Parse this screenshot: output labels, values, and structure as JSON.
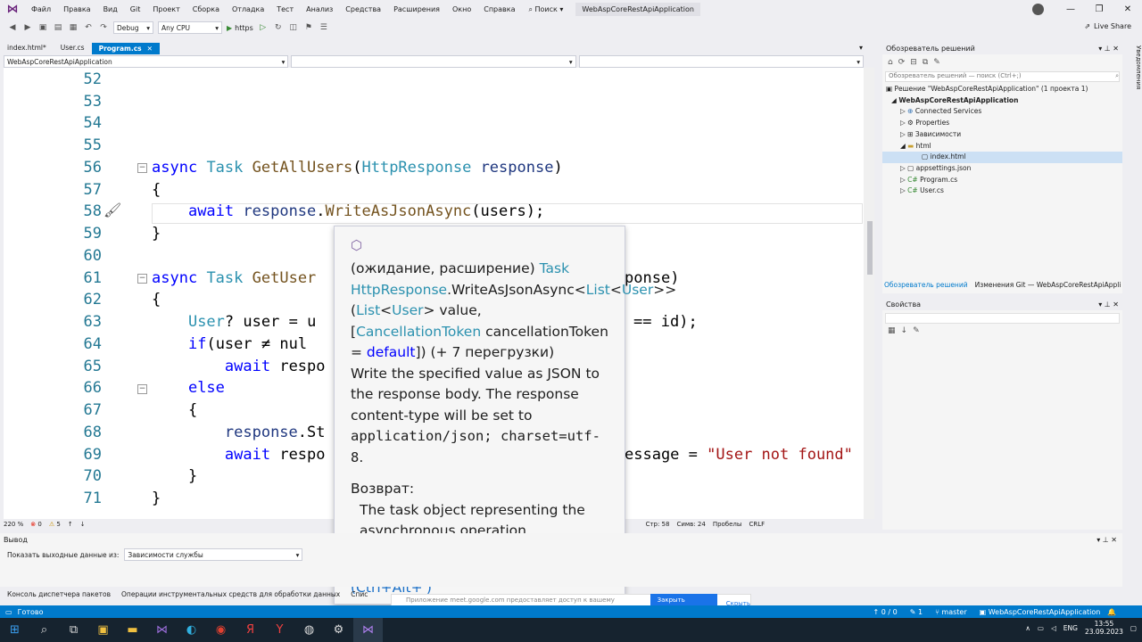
{
  "menu": {
    "items": [
      "Файл",
      "Правка",
      "Вид",
      "Git",
      "Проект",
      "Сборка",
      "Отладка",
      "Тест",
      "Анализ",
      "Средства",
      "Расширения",
      "Окно",
      "Справка"
    ],
    "search": "Поиск",
    "app_title": "WebAspCoreRestApiApplication"
  },
  "toolbar": {
    "config": "Debug",
    "platform": "Any CPU",
    "run_target": "https",
    "live_share": "Live Share"
  },
  "tabs": [
    {
      "label": "index.html*"
    },
    {
      "label": "User.cs"
    },
    {
      "label": "Program.cs",
      "active": true
    }
  ],
  "navbar": {
    "project": "WebAspCoreRestApiApplication",
    "type": "",
    "member": ""
  },
  "editor": {
    "lines": [
      {
        "num": "52",
        "text": ""
      },
      {
        "num": "53",
        "text": ""
      },
      {
        "num": "54",
        "text": ""
      },
      {
        "num": "55",
        "text": ""
      },
      {
        "num": "56",
        "text": "async Task GetAllUsers(HttpResponse response)"
      },
      {
        "num": "57",
        "text": "{"
      },
      {
        "num": "58",
        "text": "    await response.WriteAsJsonAsync(users);"
      },
      {
        "num": "59",
        "text": "}"
      },
      {
        "num": "60",
        "text": ""
      },
      {
        "num": "61",
        "text": "async Task GetUser"
      },
      {
        "num": "62",
        "text": "{"
      },
      {
        "num": "63",
        "text": "    User? user = u"
      },
      {
        "num": "64",
        "text": "    if(user ≠ nul"
      },
      {
        "num": "65",
        "text": "        await respo"
      },
      {
        "num": "66",
        "text": "    else"
      },
      {
        "num": "67",
        "text": "    {"
      },
      {
        "num": "68",
        "text": "        response.St"
      },
      {
        "num": "69",
        "text": "        await respo"
      },
      {
        "num": "70",
        "text": "    }"
      },
      {
        "num": "71",
        "text": "}"
      }
    ],
    "line61_tail": "ponse)",
    "line63_tail": "== id);",
    "line69_tail": "essage = ",
    "line69_str": "\"User not found\""
  },
  "tooltip": {
    "prefix": "(ожидание, расширение) ",
    "ret_type": "Task",
    "owner": "HttpResponse",
    "method": ".WriteAsJsonAsync<",
    "list1": "List",
    "lt": "<",
    "user1": "User",
    "gt": ">>(",
    "list2": "List",
    "user2": "User",
    "value": "> value, [",
    "ctoken": "CancellationToken",
    "ctoken_param": " cancellationToken = ",
    "default_kw": "default",
    "overloads": "]) (+ 7 перегрузки)",
    "description": "Write the specified value as JSON to the response body. The response content-type will be set to",
    "content_type": "application/json; charset=utf-8",
    "period": ".",
    "returns_label": "Возврат:",
    "returns_text": "The task object representing the asynchronous operation.",
    "link": "Примеры и документация GitHub (Ctrl+Alt+')"
  },
  "editor_status": {
    "zoom": "220 %",
    "errors": "0",
    "warnings": "5",
    "line": "Стр: 58",
    "col": "Симв: 24",
    "spaces": "Пробелы",
    "eol": "CRLF"
  },
  "solution_explorer": {
    "title": "Обозреватель решений",
    "search_placeholder": "Обозреватель решений — поиск (Ctrl+;)",
    "nodes": [
      {
        "label": "Решение \"WebAspCoreRestApiApplication\" (1 проекта 1)",
        "indent": 0
      },
      {
        "label": "WebAspCoreRestApiApplication",
        "indent": 1,
        "bold": true
      },
      {
        "label": "Connected Services",
        "indent": 2
      },
      {
        "label": "Properties",
        "indent": 2
      },
      {
        "label": "Зависимости",
        "indent": 2
      },
      {
        "label": "html",
        "indent": 2
      },
      {
        "label": "index.html",
        "indent": 3,
        "selected": true
      },
      {
        "label": "appsettings.json",
        "indent": 2
      },
      {
        "label": "Program.cs",
        "indent": 2
      },
      {
        "label": "User.cs",
        "indent": 2
      }
    ],
    "tab1": "Обозреватель решений",
    "tab2": "Изменения Git — WebAspCoreRestApiApplic..."
  },
  "properties": {
    "title": "Свойства"
  },
  "output": {
    "title": "Вывод",
    "show_from": "Показать выходные данные из:",
    "source": "Зависимости службы"
  },
  "bottom_tabs": [
    "Консоль диспетчера пакетов",
    "Операции инструментальных средств для обработки данных",
    "Спис"
  ],
  "notification": {
    "text": "Приложение meet.google.com предоставляет доступ к вашему экрану.",
    "stop": "Закрыть доступ",
    "hide": "Скрыть"
  },
  "statusbar": {
    "ready": "Готово",
    "changes": "↑ 0 / 0",
    "commits": "1",
    "branch": "master",
    "repo": "WebAspCoreRestApiApplication"
  },
  "side_tab": "Уведомления",
  "tray": {
    "lang": "ENG",
    "time": "13:55",
    "date": "23.09.2023"
  },
  "colors": {
    "accent": "#007acc",
    "keyword": "#0000ff",
    "type": "#2b91af",
    "string": "#a31515"
  }
}
